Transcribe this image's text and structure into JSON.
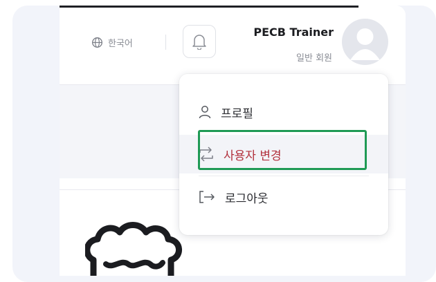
{
  "header": {
    "language": "한국어",
    "user_name": "PECB Trainer",
    "user_role": "일반 회원"
  },
  "user_menu": {
    "items": [
      {
        "label": "프로필",
        "icon": "user-icon"
      },
      {
        "label": "사용자 변경",
        "icon": "switch-arrows-icon"
      },
      {
        "label": "로그아웃",
        "icon": "logout-icon"
      }
    ]
  },
  "colors": {
    "switch_accent": "#b2303c",
    "highlight_border": "#1f9a55"
  }
}
